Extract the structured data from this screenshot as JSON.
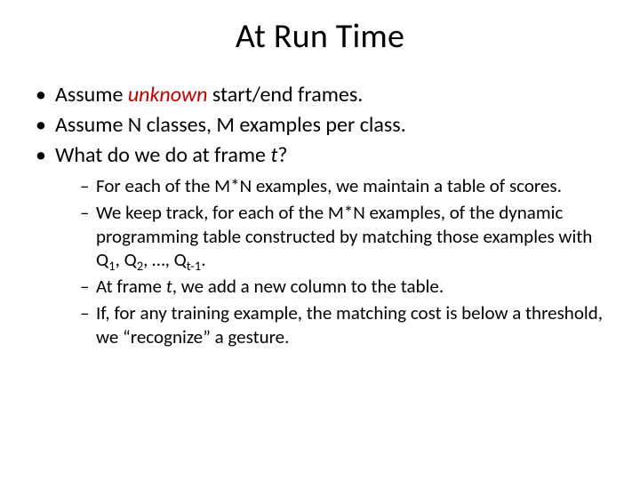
{
  "title": "At Run Time",
  "bullets": {
    "b1_pre": "Assume ",
    "b1_emph": "unknown",
    "b1_post": " start/end frames.",
    "b2": "Assume N classes, M examples per class.",
    "b3_pre": "What do we do at frame ",
    "b3_t": "t",
    "b3_post": "?"
  },
  "subs": {
    "s1": "For each of the M*N examples, we maintain a table of scores.",
    "s2_pre": "We keep track, for each of the M*N examples, of the dynamic programming table constructed by matching those examples with Q",
    "s2_idx1": "1",
    "s2_mid1": ", Q",
    "s2_idx2": "2",
    "s2_mid2": ", …, Q",
    "s2_idx3": "t-1",
    "s2_post": ".",
    "s3_pre": "At frame ",
    "s3_t": "t",
    "s3_post": ", we add a new column to the table.",
    "s4": "If, for any training example, the matching cost is below a threshold, we “recognize” a gesture."
  }
}
